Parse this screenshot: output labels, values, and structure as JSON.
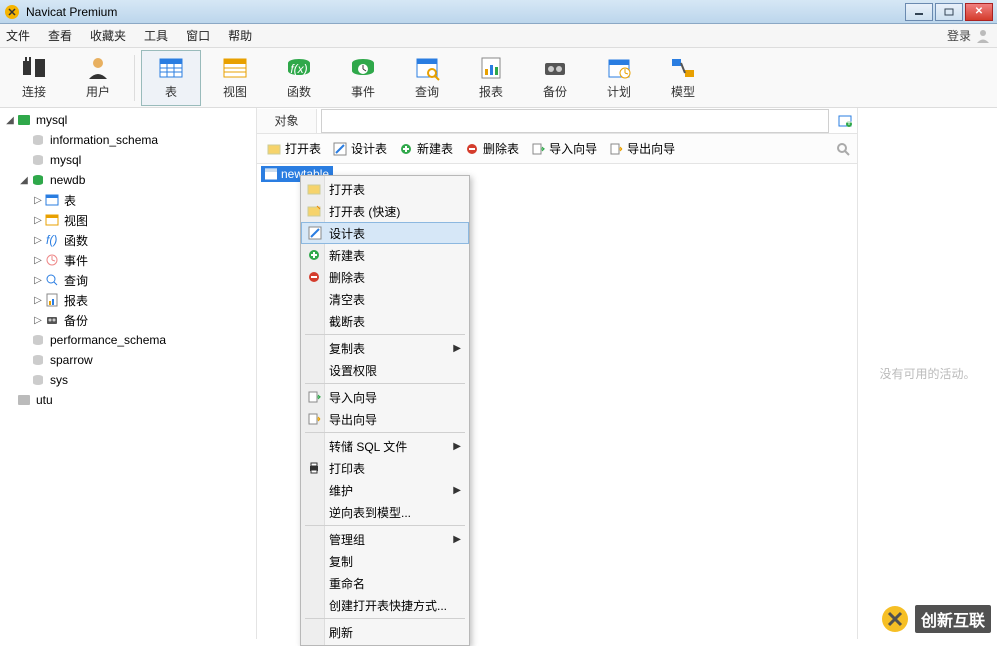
{
  "window": {
    "title": "Navicat Premium"
  },
  "menubar": {
    "items": [
      "文件",
      "查看",
      "收藏夹",
      "工具",
      "窗口",
      "帮助"
    ],
    "login": "登录"
  },
  "toolbar": {
    "items": [
      {
        "label": "连接"
      },
      {
        "label": "用户"
      },
      {
        "label": "表"
      },
      {
        "label": "视图"
      },
      {
        "label": "函数"
      },
      {
        "label": "事件"
      },
      {
        "label": "查询"
      },
      {
        "label": "报表"
      },
      {
        "label": "备份"
      },
      {
        "label": "计划"
      },
      {
        "label": "模型"
      }
    ]
  },
  "sidebar": {
    "conn1": "mysql",
    "dbs": [
      "information_schema",
      "mysql"
    ],
    "db_open": "newdb",
    "folders": [
      "表",
      "视图",
      "函数",
      "事件",
      "查询",
      "报表",
      "备份"
    ],
    "db_rest": [
      "performance_schema",
      "sparrow",
      "sys"
    ],
    "conn2": "utu"
  },
  "main": {
    "tab": "对象",
    "actions": [
      "打开表",
      "设计表",
      "新建表",
      "删除表",
      "导入向导",
      "导出向导"
    ],
    "selected_table": "newtable",
    "right_panel_text": "没有可用的活动。"
  },
  "context_menu": {
    "groups": [
      [
        {
          "label": "打开表",
          "icon": "open"
        },
        {
          "label": "打开表 (快速)",
          "icon": "open-fast"
        },
        {
          "label": "设计表",
          "icon": "design",
          "hover": true
        },
        {
          "label": "新建表",
          "icon": "new"
        },
        {
          "label": "删除表",
          "icon": "delete"
        },
        {
          "label": "清空表"
        },
        {
          "label": "截断表"
        }
      ],
      [
        {
          "label": "复制表",
          "sub": true
        },
        {
          "label": "设置权限"
        }
      ],
      [
        {
          "label": "导入向导",
          "icon": "import"
        },
        {
          "label": "导出向导",
          "icon": "export"
        }
      ],
      [
        {
          "label": "转储 SQL 文件",
          "sub": true
        },
        {
          "label": "打印表",
          "icon": "print"
        },
        {
          "label": "维护",
          "sub": true
        },
        {
          "label": "逆向表到模型..."
        }
      ],
      [
        {
          "label": "管理组",
          "sub": true
        },
        {
          "label": "复制"
        },
        {
          "label": "重命名"
        },
        {
          "label": "创建打开表快捷方式..."
        }
      ],
      [
        {
          "label": "刷新"
        }
      ]
    ]
  },
  "watermark": {
    "text": "创新互联"
  }
}
